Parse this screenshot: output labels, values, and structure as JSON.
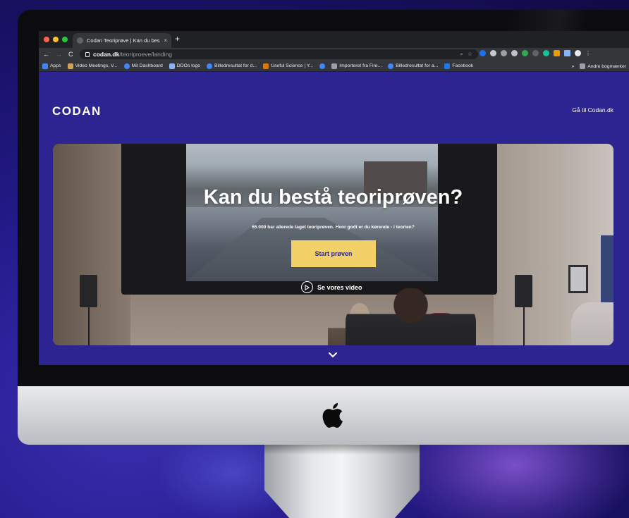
{
  "browser": {
    "tab_title": "Codan Teoriprøve | Kan du bes",
    "tab_close": "×",
    "new_tab": "+",
    "url_host": "codan.dk",
    "url_path": "/teoriproeve/landing",
    "nav": {
      "back": "←",
      "forward": "→",
      "reload": "C"
    },
    "omni_icons": {
      "zoom": "⌕",
      "star": "☆"
    },
    "bookmarks": [
      {
        "label": "Apps",
        "icon": "apps-grid-icon",
        "color": "#4285f4"
      },
      {
        "label": "Video Meetings, V...",
        "icon": "video-icon",
        "color": "#d1a35a"
      },
      {
        "label": "Mit Dashboard",
        "icon": "google-icon",
        "color": "#4285f4"
      },
      {
        "label": "DDOs logo",
        "icon": "image-icon",
        "color": "#8ab4f8"
      },
      {
        "label": "Billedresultat for d...",
        "icon": "google-icon",
        "color": "#4285f4"
      },
      {
        "label": "Useful Science | Y...",
        "icon": "science-icon",
        "color": "#e37400"
      },
      {
        "label": "",
        "icon": "circle-icon",
        "color": "#4285f4"
      },
      {
        "label": "Importeret fra Fire...",
        "icon": "folder-icon",
        "color": "#9aa0a6"
      },
      {
        "label": "Billedresultat for a...",
        "icon": "google-icon",
        "color": "#4285f4"
      },
      {
        "label": "Facebook",
        "icon": "facebook-icon",
        "color": "#1877f2"
      }
    ],
    "bookmarks_more": "»",
    "other_bookmarks": "Andre bogmærker"
  },
  "page": {
    "logo": "CODAN",
    "top_link": "Gå til Codan.dk",
    "hero": {
      "title": "Kan du bestå teoriprøven?",
      "subtitle": "65.000 har allerede taget teoriprøven. Hvor godt er du kørende - i teorien?",
      "cta_label": "Start prøven",
      "video_label": "Se vores video"
    },
    "colors": {
      "brand": "#2c2591",
      "cta": "#f2d268"
    }
  }
}
